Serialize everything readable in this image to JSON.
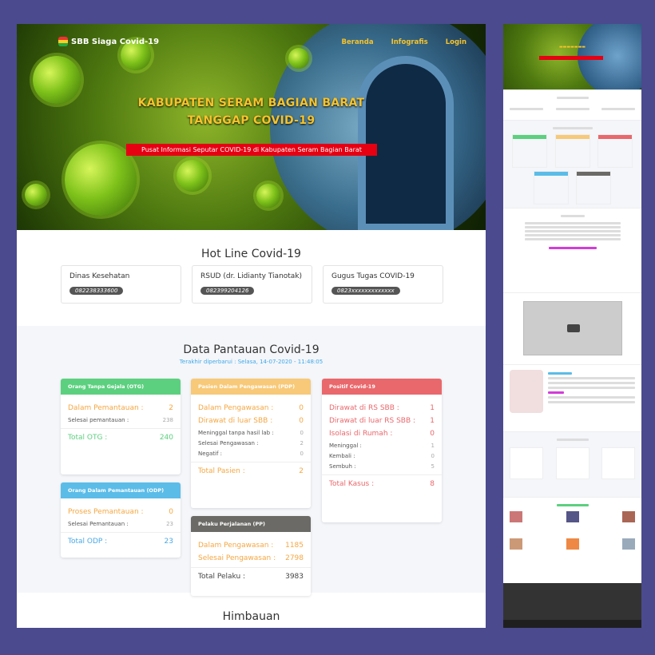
{
  "site": {
    "brand": "SBB Siaga Covid-19",
    "nav": [
      "Beranda",
      "Infografis",
      "Login"
    ],
    "hero_title_line1": "KABUPATEN SERAM BAGIAN BARAT",
    "hero_title_line2": "TANGGAP COVID-19",
    "hero_subtitle": "Pusat Informasi Seputar COVID-19 di Kabupaten Seram Bagian Barat"
  },
  "hotline": {
    "title": "Hot Line Covid-19",
    "items": [
      {
        "name": "Dinas Kesehatan",
        "phone": "082238333600"
      },
      {
        "name": "RSUD (dr. Lidianty Tianotak)",
        "phone": "082399204126"
      },
      {
        "name": "Gugus Tugas COVID-19",
        "phone": "0823xxxxxxxxxxxxx"
      }
    ]
  },
  "monitoring": {
    "title": "Data Pantauan Covid-19",
    "updated": "Terakhir diperbarui : Selasa, 14-07-2020 - 11:48:05",
    "otg": {
      "header": "Orang Tanpa Gejala (OTG)",
      "dalam_label": "Dalam Pemantauan :",
      "dalam_value": "2",
      "selesai_label": "Selesai pemantauan :",
      "selesai_value": "238",
      "total_label": "Total OTG :",
      "total_value": "240"
    },
    "odp": {
      "header": "Orang Dalam Pemantauan (ODP)",
      "proses_label": "Proses Pemantauan :",
      "proses_value": "0",
      "selesai_label": "Selesai Pemantauan :",
      "selesai_value": "23",
      "total_label": "Total ODP :",
      "total_value": "23"
    },
    "pdp": {
      "header": "Pasien Dalam Pengawasan (PDP)",
      "dalam_label": "Dalam Pengawasan :",
      "dalam_value": "0",
      "dirawat_label": "Dirawat di luar SBB :",
      "dirawat_value": "0",
      "meninggal_label": "Meninggal tanpa hasil lab :",
      "meninggal_value": "0",
      "selesai_label": "Selesai Pengawasan :",
      "selesai_value": "2",
      "negatif_label": "Negatif :",
      "negatif_value": "0",
      "total_label": "Total Pasien :",
      "total_value": "2"
    },
    "pp": {
      "header": "Pelaku Perjalanan (PP)",
      "dalam_label": "Dalam Pengawasan :",
      "dalam_value": "1185",
      "selesai_label": "Selesai Pengawasan :",
      "selesai_value": "2798",
      "total_label": "Total Pelaku :",
      "total_value": "3983"
    },
    "positif": {
      "header": "Positif Covid-19",
      "rs_sbb_label": "Dirawat di RS SBB :",
      "rs_sbb_value": "1",
      "luar_label": "Dirawat di luar RS SBB :",
      "luar_value": "1",
      "isolasi_label": "Isolasi di Rumah :",
      "isolasi_value": "0",
      "meninggal_label": "Meninggal :",
      "meninggal_value": "1",
      "kembali_label": "Kembali :",
      "kembali_value": "0",
      "sembuh_label": "Sembuh :",
      "sembuh_value": "5",
      "total_label": "Total Kasus :",
      "total_value": "8"
    }
  },
  "himbauan": {
    "title": "Himbauan"
  },
  "colors": {
    "otg": "#5cd07f",
    "odp": "#5bbce8",
    "pdp": "#f7c978",
    "pp": "#6b6a66",
    "positif": "#e9686c",
    "accent": "#f6c32c"
  }
}
